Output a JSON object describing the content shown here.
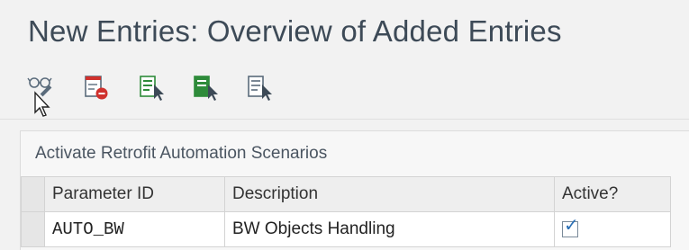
{
  "header": {
    "title": "New Entries: Overview of Added Entries"
  },
  "toolbar": {
    "buttons": [
      {
        "name": "display-change-icon"
      },
      {
        "name": "delete-icon"
      },
      {
        "name": "select-all-icon"
      },
      {
        "name": "select-block-icon"
      },
      {
        "name": "deselect-all-icon"
      }
    ]
  },
  "panel": {
    "title": "Activate Retrofit Automation Scenarios",
    "columns": [
      "Parameter ID",
      "Description",
      "Active?"
    ],
    "rows": [
      {
        "parameter_id": "AUTO_BW",
        "description": "BW Objects Handling",
        "active": true
      }
    ]
  },
  "colors": {
    "accent_green": "#2e8b3a",
    "delete_red": "#d0312d",
    "check_blue": "#2a6fb5"
  }
}
